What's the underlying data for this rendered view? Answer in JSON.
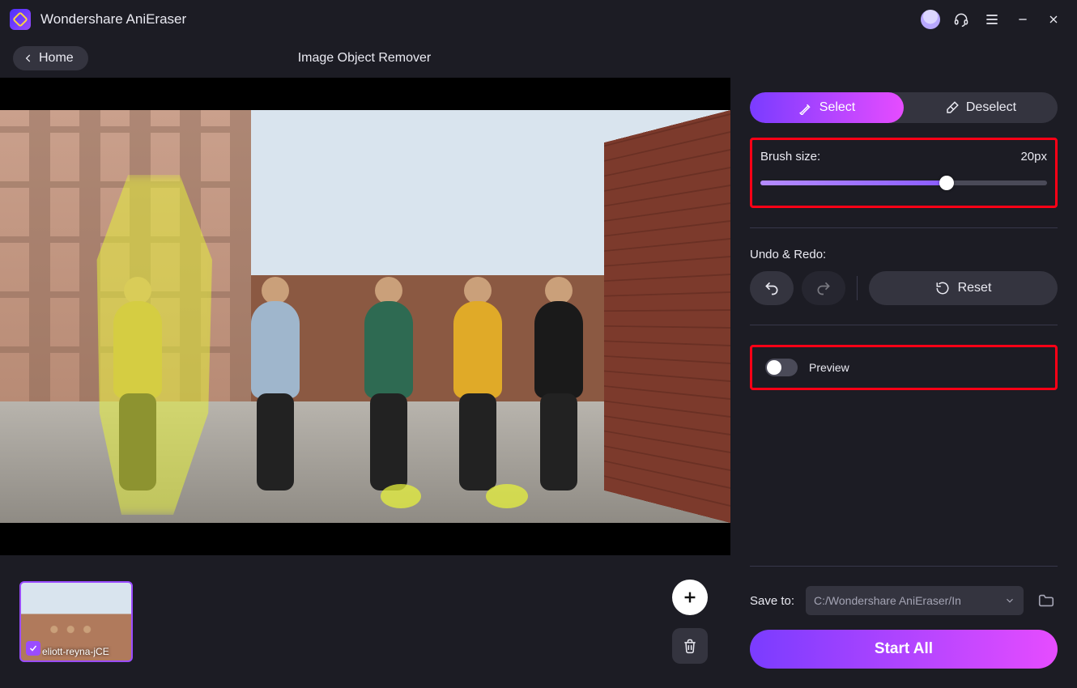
{
  "app": {
    "name": "Wondershare AniEraser"
  },
  "toolbar": {
    "home": "Home",
    "title": "Image Object Remover"
  },
  "segment": {
    "select": "Select",
    "deselect": "Deselect"
  },
  "brush": {
    "label": "Brush size:",
    "value": "20px",
    "percent": 65
  },
  "undo": {
    "label": "Undo & Redo:",
    "reset": "Reset"
  },
  "preview": {
    "label": "Preview",
    "on": false
  },
  "save": {
    "label": "Save to:",
    "path": "C:/Wondershare AniEraser/In"
  },
  "start": {
    "label": "Start All"
  },
  "thumb": {
    "filename": "eliott-reyna-jCE"
  }
}
